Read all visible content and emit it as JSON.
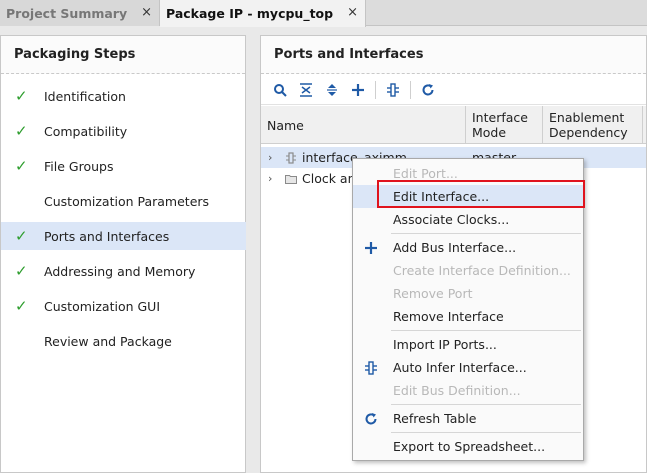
{
  "tabs": [
    {
      "label": "Project Summary",
      "close": "×"
    },
    {
      "label": "Package IP - mycpu_top",
      "close": "×"
    }
  ],
  "left_panel": {
    "title": "Packaging Steps",
    "steps": [
      {
        "label": "Identification",
        "check": "✓"
      },
      {
        "label": "Compatibility",
        "check": "✓"
      },
      {
        "label": "File Groups",
        "check": "✓"
      },
      {
        "label": "Customization Parameters",
        "check": ""
      },
      {
        "label": "Ports and Interfaces",
        "check": "✓"
      },
      {
        "label": "Addressing and Memory",
        "check": "✓"
      },
      {
        "label": "Customization GUI",
        "check": "✓"
      },
      {
        "label": "Review and Package",
        "check": ""
      }
    ]
  },
  "right_panel": {
    "title": "Ports and Interfaces",
    "toolbar_icons": [
      "search-icon",
      "collapse-all-icon",
      "expand-all-icon",
      "add-icon",
      "auto-infer-icon",
      "refresh-icon"
    ],
    "columns": {
      "name": "Name",
      "mode": "Interface Mode",
      "enablement": "Enablement Dependency"
    },
    "rows": [
      {
        "name": "interface_aximm",
        "mode": "master"
      },
      {
        "name": "Clock and",
        "mode": ""
      }
    ]
  },
  "context_menu": {
    "items": [
      {
        "label": "Edit Port...",
        "enabled": false
      },
      {
        "label": "Edit Interface...",
        "enabled": true
      },
      {
        "label": "Associate Clocks...",
        "enabled": true
      },
      {
        "label": "Add Bus Interface...",
        "enabled": true
      },
      {
        "label": "Create Interface Definition...",
        "enabled": false
      },
      {
        "label": "Remove Port",
        "enabled": false
      },
      {
        "label": "Remove Interface",
        "enabled": true
      },
      {
        "label": "Import IP Ports...",
        "enabled": true
      },
      {
        "label": "Auto Infer Interface...",
        "enabled": true
      },
      {
        "label": "Edit Bus Definition...",
        "enabled": false
      },
      {
        "label": "Refresh Table",
        "enabled": true
      },
      {
        "label": "Export to Spreadsheet...",
        "enabled": true
      }
    ]
  },
  "colors": {
    "accent": "#1f5aa6",
    "check": "#2f9e2f",
    "selection": "#dbe6f7",
    "highlight": "#e0131d"
  }
}
